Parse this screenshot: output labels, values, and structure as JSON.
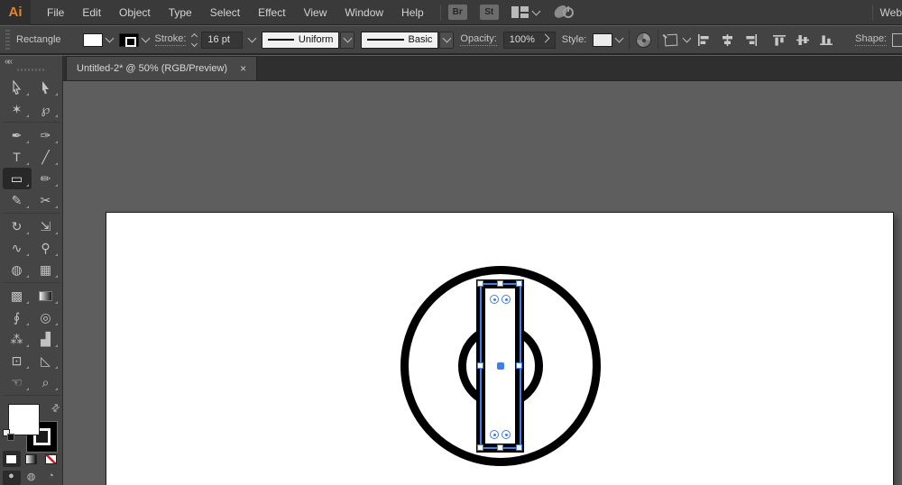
{
  "menubar": {
    "logo": "Ai",
    "items": [
      "File",
      "Edit",
      "Object",
      "Type",
      "Select",
      "Effect",
      "View",
      "Window",
      "Help"
    ],
    "bridge_button": "Br",
    "stock_button": "St",
    "workspace_label": "Web"
  },
  "controlbar": {
    "context_label": "Rectangle",
    "stroke_label": "Stroke:",
    "stroke_weight": "16 pt",
    "width_profile": "Uniform",
    "brush_definition": "Basic",
    "opacity_label": "Opacity:",
    "opacity_value": "100%",
    "style_label": "Style:",
    "shape_label": "Shape:"
  },
  "document_tab": {
    "title": "Untitled-2* @ 50% (RGB/Preview)",
    "close_glyph": "×"
  },
  "toolbar": {
    "collapse_glyph": "««",
    "swap_glyph": "⇄",
    "dividers_after": [
      3,
      11,
      17,
      27
    ],
    "tools": [
      {
        "name": "selection-tool",
        "glyph": "@arrow-outline"
      },
      {
        "name": "direct-selection-tool",
        "glyph": "@arrow-filled"
      },
      {
        "name": "magic-wand-tool",
        "glyph": "✶"
      },
      {
        "name": "lasso-tool",
        "glyph": "℘"
      },
      {
        "name": "pen-tool",
        "glyph": "✒"
      },
      {
        "name": "curvature-tool",
        "glyph": "✑"
      },
      {
        "name": "type-tool",
        "glyph": "T"
      },
      {
        "name": "line-segment-tool",
        "glyph": "╱"
      },
      {
        "name": "rectangle-tool",
        "glyph": "▭",
        "selected": true
      },
      {
        "name": "paintbrush-tool",
        "glyph": "✏"
      },
      {
        "name": "shaper-tool",
        "glyph": "✎"
      },
      {
        "name": "scissors-tool",
        "glyph": "✂"
      },
      {
        "name": "rotate-tool",
        "glyph": "↻"
      },
      {
        "name": "scale-tool",
        "glyph": "⇲"
      },
      {
        "name": "width-tool",
        "glyph": "∿"
      },
      {
        "name": "puppet-warp-tool",
        "glyph": "⚲"
      },
      {
        "name": "shape-builder-tool",
        "glyph": "◍"
      },
      {
        "name": "perspective-grid-tool",
        "glyph": "▦"
      },
      {
        "name": "mesh-tool",
        "glyph": "▩"
      },
      {
        "name": "gradient-tool",
        "glyph": "@gradient"
      },
      {
        "name": "eyedropper-tool",
        "glyph": "∮"
      },
      {
        "name": "blend-tool",
        "glyph": "◎"
      },
      {
        "name": "symbol-sprayer-tool",
        "glyph": "⁂"
      },
      {
        "name": "column-graph-tool",
        "glyph": "▟"
      },
      {
        "name": "artboard-tool",
        "glyph": "⊡"
      },
      {
        "name": "slice-tool",
        "glyph": "◺"
      },
      {
        "name": "hand-tool",
        "glyph": "☜"
      },
      {
        "name": "zoom-tool",
        "glyph": "⌕"
      }
    ],
    "drawing_modes": [
      "●",
      "◍",
      "◔"
    ]
  },
  "canvas": {
    "artwork": [
      "outer-circle",
      "inner-circle",
      "selected-rectangle"
    ],
    "selection": "rectangle with 8 handles, center point and 4 live-corner widgets"
  },
  "colors": {
    "selection_blue": "#3f7de8",
    "artwork_stroke": "#000000",
    "canvas_background": "#5e5e5e",
    "logo_orange": "#e8842c",
    "none_red": "#d42020"
  }
}
